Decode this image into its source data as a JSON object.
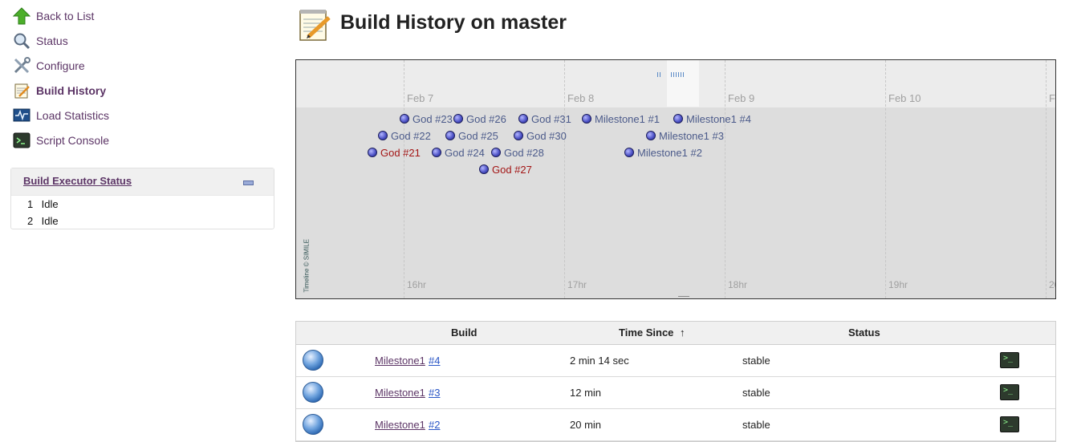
{
  "sidebar": {
    "tasks": [
      {
        "label": "Back to List",
        "icon": "up-arrow-icon"
      },
      {
        "label": "Status",
        "icon": "magnifier-icon"
      },
      {
        "label": "Configure",
        "icon": "tools-icon"
      },
      {
        "label": "Build History",
        "icon": "notepad-icon",
        "selected": true
      },
      {
        "label": "Load Statistics",
        "icon": "monitor-graph-icon"
      },
      {
        "label": "Script Console",
        "icon": "terminal-icon"
      }
    ],
    "executor": {
      "title": "Build Executor Status",
      "rows": [
        {
          "num": "1",
          "state": "Idle"
        },
        {
          "num": "2",
          "state": "Idle"
        }
      ]
    }
  },
  "page_title": "Build History on master",
  "timeline": {
    "dates": [
      "Feb 7",
      "Feb 8",
      "Feb 9",
      "Feb 10",
      "F"
    ],
    "hours": [
      "16hr",
      "17hr",
      "18hr",
      "19hr",
      "20"
    ],
    "credit": "Timeline © SIMILE",
    "events": [
      {
        "label": "God #23",
        "failed": false
      },
      {
        "label": "God #26",
        "failed": false
      },
      {
        "label": "God #31",
        "failed": false
      },
      {
        "label": "Milestone1 #1",
        "failed": false
      },
      {
        "label": "Milestone1 #4",
        "failed": false
      },
      {
        "label": "God #22",
        "failed": false
      },
      {
        "label": "God #25",
        "failed": false
      },
      {
        "label": "God #30",
        "failed": false
      },
      {
        "label": "Milestone1 #3",
        "failed": false
      },
      {
        "label": "God #21",
        "failed": true
      },
      {
        "label": "God #24",
        "failed": false
      },
      {
        "label": "God #28",
        "failed": false
      },
      {
        "label": "Milestone1 #2",
        "failed": false
      },
      {
        "label": "God #27",
        "failed": true
      }
    ]
  },
  "table": {
    "headers": {
      "build": "Build",
      "time": "Time Since",
      "sort_arrow": "↑",
      "status": "Status"
    },
    "rows": [
      {
        "name": "Milestone1",
        "num": "#4",
        "time": "2 min 14 sec",
        "status": "stable"
      },
      {
        "name": "Milestone1",
        "num": "#3",
        "time": "12 min",
        "status": "stable"
      },
      {
        "name": "Milestone1",
        "num": "#2",
        "time": "20 min",
        "status": "stable"
      }
    ]
  },
  "colors": {
    "link": "#5c3566",
    "failed": "#a31515",
    "event_text": "#4b5a8a"
  }
}
